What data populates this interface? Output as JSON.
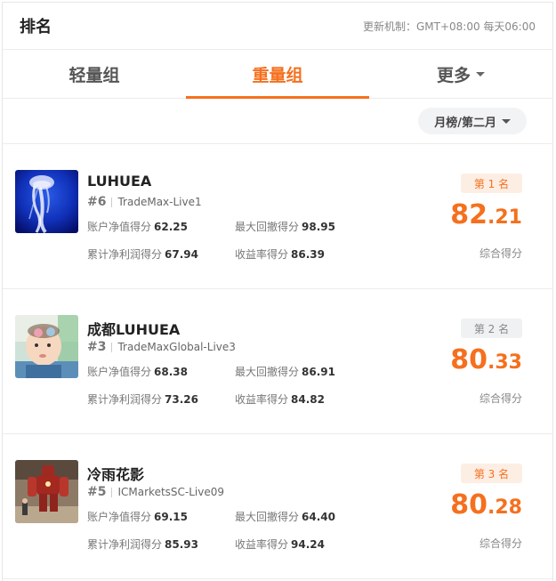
{
  "header": {
    "title": "排名",
    "update_info": "更新机制：GMT+08:00 每天06:00"
  },
  "tabs": [
    {
      "label": "轻量组",
      "active": false
    },
    {
      "label": "重量组",
      "active": true
    },
    {
      "label": "更多",
      "active": false
    }
  ],
  "filter": {
    "label": "月榜/第二月"
  },
  "colors": {
    "accent": "#f5701e"
  },
  "rankings": [
    {
      "name": "LUHUEA",
      "num": "#6",
      "account": "TradeMax-Live1",
      "equity_label": "账户净值得分",
      "equity": "62.25",
      "drawdown_label": "最大回撤得分",
      "drawdown": "98.95",
      "profit_label": "累计净利润得分",
      "profit": "67.94",
      "return_label": "收益率得分",
      "return": "86.39",
      "badge": "第 1 名",
      "score_int": "82",
      "score_dec": "21",
      "score_label": "综合得分",
      "avatar_icon": "jellyfish-photo"
    },
    {
      "name": "成都LUHUEA",
      "num": "#3",
      "account": "TradeMaxGlobal-Live3",
      "equity_label": "账户净值得分",
      "equity": "68.38",
      "drawdown_label": "最大回撤得分",
      "drawdown": "86.91",
      "profit_label": "累计净利润得分",
      "profit": "73.26",
      "return_label": "收益率得分",
      "return": "84.82",
      "badge": "第 2 名",
      "score_int": "80",
      "score_dec": "33",
      "score_label": "综合得分",
      "avatar_icon": "baby-photo"
    },
    {
      "name": "冷雨花影",
      "num": "#5",
      "account": "ICMarketsSC-Live09",
      "equity_label": "账户净值得分",
      "equity": "69.15",
      "drawdown_label": "最大回撤得分",
      "drawdown": "64.40",
      "profit_label": "累计净利润得分",
      "profit": "85.93",
      "return_label": "收益率得分",
      "return": "94.24",
      "badge": "第 3 名",
      "score_int": "80",
      "score_dec": "28",
      "score_label": "综合得分",
      "avatar_icon": "robot-statue-photo"
    }
  ]
}
